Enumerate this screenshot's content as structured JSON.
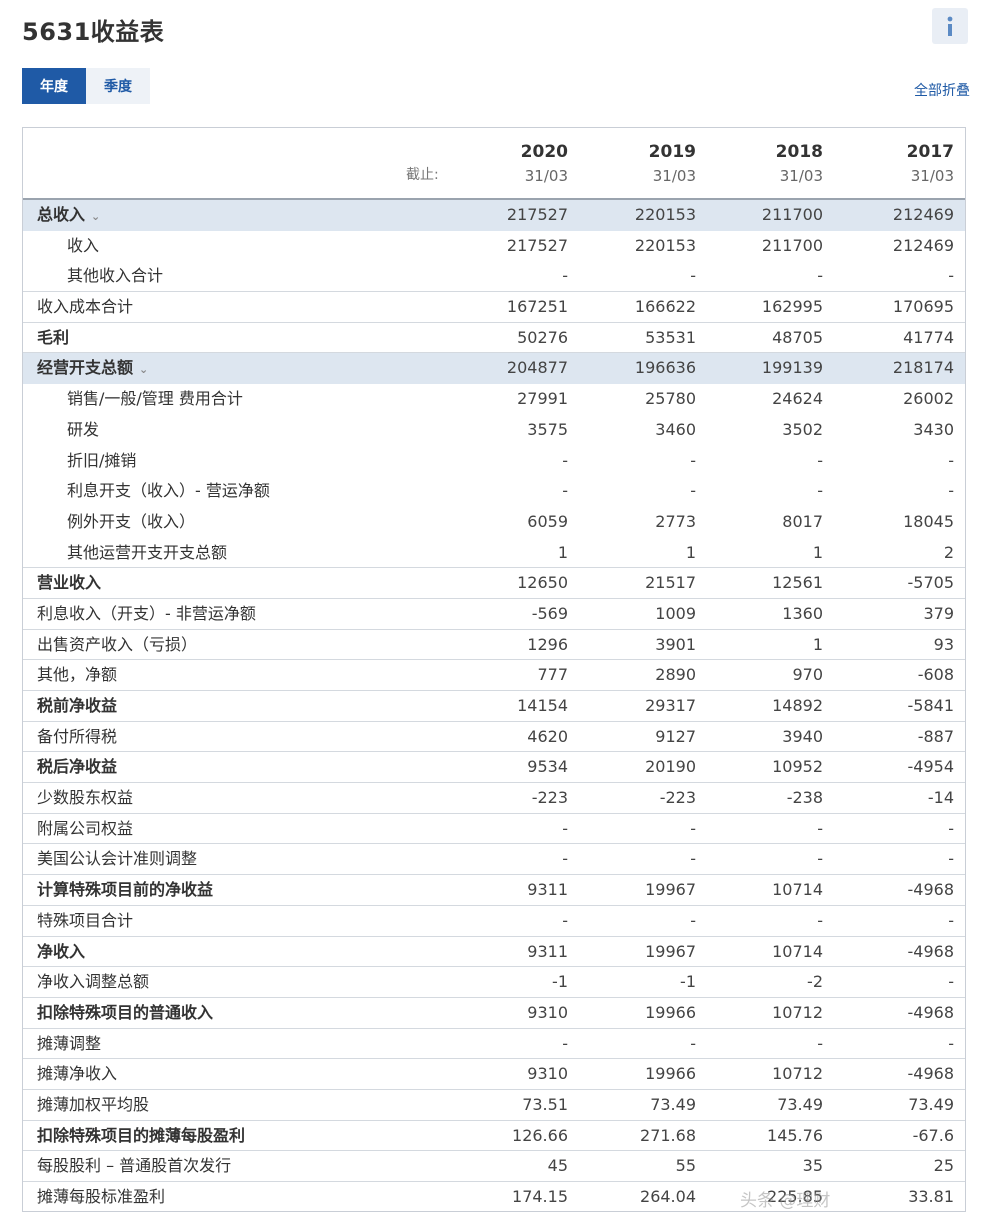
{
  "title": "5631收益表",
  "tabs": [
    {
      "label": "年度"
    },
    {
      "label": "季度"
    }
  ],
  "collapse_all": "全部折叠",
  "header": {
    "as_of_label": "截止:",
    "columns": [
      {
        "year": "2020",
        "date": "31/03"
      },
      {
        "year": "2019",
        "date": "31/03"
      },
      {
        "year": "2018",
        "date": "31/03"
      },
      {
        "year": "2017",
        "date": "31/03"
      }
    ]
  },
  "rows": [
    {
      "label": "总收入",
      "values": [
        "217527",
        "220153",
        "211700",
        "212469"
      ],
      "bold": true,
      "highlight": true,
      "expander": true,
      "indent": false,
      "border": false
    },
    {
      "label": "收入",
      "values": [
        "217527",
        "220153",
        "211700",
        "212469"
      ],
      "bold": false,
      "highlight": false,
      "indent": true,
      "border": false
    },
    {
      "label": "其他收入合计",
      "values": [
        "-",
        "-",
        "-",
        "-"
      ],
      "bold": false,
      "highlight": false,
      "indent": true,
      "border": true
    },
    {
      "label": "收入成本合计",
      "values": [
        "167251",
        "166622",
        "162995",
        "170695"
      ],
      "bold": false,
      "highlight": false,
      "indent": false,
      "border": true
    },
    {
      "label": "毛利",
      "values": [
        "50276",
        "53531",
        "48705",
        "41774"
      ],
      "bold": true,
      "highlight": false,
      "indent": false,
      "border": true
    },
    {
      "label": "经营开支总额",
      "values": [
        "204877",
        "196636",
        "199139",
        "218174"
      ],
      "bold": true,
      "highlight": true,
      "expander": true,
      "indent": false,
      "border": false
    },
    {
      "label": "销售/一般/管理 费用合计",
      "values": [
        "27991",
        "25780",
        "24624",
        "26002"
      ],
      "bold": false,
      "highlight": false,
      "indent": true,
      "border": false
    },
    {
      "label": "研发",
      "values": [
        "3575",
        "3460",
        "3502",
        "3430"
      ],
      "bold": false,
      "highlight": false,
      "indent": true,
      "border": false
    },
    {
      "label": "折旧/摊销",
      "values": [
        "-",
        "-",
        "-",
        "-"
      ],
      "bold": false,
      "highlight": false,
      "indent": true,
      "border": false
    },
    {
      "label": "利息开支（收入）- 营运净额",
      "values": [
        "-",
        "-",
        "-",
        "-"
      ],
      "bold": false,
      "highlight": false,
      "indent": true,
      "border": false
    },
    {
      "label": "例外开支（收入）",
      "values": [
        "6059",
        "2773",
        "8017",
        "18045"
      ],
      "bold": false,
      "highlight": false,
      "indent": true,
      "border": false
    },
    {
      "label": "其他运营开支开支总额",
      "values": [
        "1",
        "1",
        "1",
        "2"
      ],
      "bold": false,
      "highlight": false,
      "indent": true,
      "border": true
    },
    {
      "label": "营业收入",
      "values": [
        "12650",
        "21517",
        "12561",
        "-5705"
      ],
      "bold": true,
      "highlight": false,
      "indent": false,
      "border": true
    },
    {
      "label": "利息收入（开支）- 非营运净额",
      "values": [
        "-569",
        "1009",
        "1360",
        "379"
      ],
      "bold": false,
      "highlight": false,
      "indent": false,
      "border": true
    },
    {
      "label": "出售资产收入（亏损）",
      "values": [
        "1296",
        "3901",
        "1",
        "93"
      ],
      "bold": false,
      "highlight": false,
      "indent": false,
      "border": true
    },
    {
      "label": "其他，净额",
      "values": [
        "777",
        "2890",
        "970",
        "-608"
      ],
      "bold": false,
      "highlight": false,
      "indent": false,
      "border": true
    },
    {
      "label": "税前净收益",
      "values": [
        "14154",
        "29317",
        "14892",
        "-5841"
      ],
      "bold": true,
      "highlight": false,
      "indent": false,
      "border": true
    },
    {
      "label": "备付所得税",
      "values": [
        "4620",
        "9127",
        "3940",
        "-887"
      ],
      "bold": false,
      "highlight": false,
      "indent": false,
      "border": true
    },
    {
      "label": "税后净收益",
      "values": [
        "9534",
        "20190",
        "10952",
        "-4954"
      ],
      "bold": true,
      "highlight": false,
      "indent": false,
      "border": true
    },
    {
      "label": "少数股东权益",
      "values": [
        "-223",
        "-223",
        "-238",
        "-14"
      ],
      "bold": false,
      "highlight": false,
      "indent": false,
      "border": true
    },
    {
      "label": "附属公司权益",
      "values": [
        "-",
        "-",
        "-",
        "-"
      ],
      "bold": false,
      "highlight": false,
      "indent": false,
      "border": true
    },
    {
      "label": "美国公认会计准则调整",
      "values": [
        "-",
        "-",
        "-",
        "-"
      ],
      "bold": false,
      "highlight": false,
      "indent": false,
      "border": true
    },
    {
      "label": "计算特殊项目前的净收益",
      "values": [
        "9311",
        "19967",
        "10714",
        "-4968"
      ],
      "bold": true,
      "highlight": false,
      "indent": false,
      "border": true
    },
    {
      "label": "特殊项目合计",
      "values": [
        "-",
        "-",
        "-",
        "-"
      ],
      "bold": false,
      "highlight": false,
      "indent": false,
      "border": true
    },
    {
      "label": "净收入",
      "values": [
        "9311",
        "19967",
        "10714",
        "-4968"
      ],
      "bold": true,
      "highlight": false,
      "indent": false,
      "border": true
    },
    {
      "label": "净收入调整总额",
      "values": [
        "-1",
        "-1",
        "-2",
        "-"
      ],
      "bold": false,
      "highlight": false,
      "indent": false,
      "border": true
    },
    {
      "label": "扣除特殊项目的普通收入",
      "values": [
        "9310",
        "19966",
        "10712",
        "-4968"
      ],
      "bold": true,
      "highlight": false,
      "indent": false,
      "border": true
    },
    {
      "label": "摊薄调整",
      "values": [
        "-",
        "-",
        "-",
        "-"
      ],
      "bold": false,
      "highlight": false,
      "indent": false,
      "border": true
    },
    {
      "label": "摊薄净收入",
      "values": [
        "9310",
        "19966",
        "10712",
        "-4968"
      ],
      "bold": false,
      "highlight": false,
      "indent": false,
      "border": true
    },
    {
      "label": "摊薄加权平均股",
      "values": [
        "73.51",
        "73.49",
        "73.49",
        "73.49"
      ],
      "bold": false,
      "highlight": false,
      "indent": false,
      "border": true
    },
    {
      "label": "扣除特殊项目的摊薄每股盈利",
      "values": [
        "126.66",
        "271.68",
        "145.76",
        "-67.6"
      ],
      "bold": true,
      "highlight": false,
      "indent": false,
      "border": true
    },
    {
      "label": "每股股利 – 普通股首次发行",
      "values": [
        "45",
        "55",
        "35",
        "25"
      ],
      "bold": false,
      "highlight": false,
      "indent": false,
      "border": true
    },
    {
      "label": "摊薄每股标准盈利",
      "values": [
        "174.15",
        "264.04",
        "225.85",
        "33.81"
      ],
      "bold": false,
      "highlight": false,
      "indent": false,
      "border": false
    }
  ],
  "watermark": "头条 @理财"
}
